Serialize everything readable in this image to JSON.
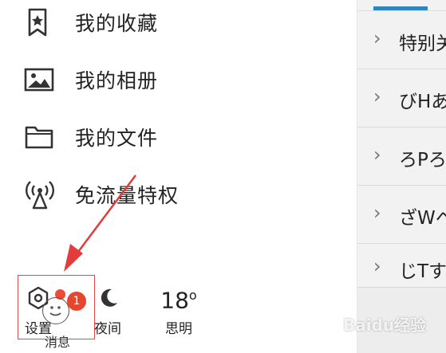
{
  "menu": {
    "items": [
      {
        "label": "我的收藏",
        "icon": "bookmark-star-icon"
      },
      {
        "label": "我的相册",
        "icon": "image-icon"
      },
      {
        "label": "我的文件",
        "icon": "folder-icon"
      },
      {
        "label": "免流量特权",
        "icon": "antenna-icon"
      }
    ]
  },
  "bottom_bar": {
    "settings_label": "设置",
    "night_label": "夜间",
    "weather_temp": "18",
    "weather_unit": "o",
    "weather_city": "思明"
  },
  "right_panel": {
    "rows": [
      "特别关",
      "びHあ",
      "ろPろ",
      "ざWヘ",
      "じTす"
    ],
    "badge_count": "1",
    "message_label": "消息"
  },
  "watermark": "Baidu经验",
  "colors": {
    "accent": "#2d86c2",
    "badge": "#e8452e",
    "dot": "#f04b34",
    "arrow": "#e23c3c"
  }
}
